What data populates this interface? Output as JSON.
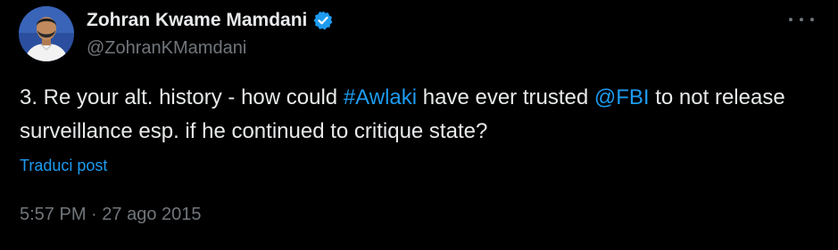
{
  "author": {
    "name": "Zohran Kwame Mamdani",
    "handle": "@ZohranKMamdani",
    "verified": true
  },
  "icons": {
    "verified": "verified-badge-icon",
    "more": "more-options-icon",
    "avatar": "profile-avatar"
  },
  "tweet": {
    "text_part1": "3. Re your alt. history - how could ",
    "hashtag": "#Awlaki",
    "text_part2": " have ever trusted ",
    "mention": "@FBI",
    "text_part3": " to not release surveillance esp. if he continued to critique state?"
  },
  "translate_label": "Traduci post",
  "timestamp": {
    "time": "5:57 PM",
    "separator": " · ",
    "date": "27 ago 2015"
  },
  "colors": {
    "background": "#000000",
    "text": "#e7e9ea",
    "muted": "#71767b",
    "link": "#1d9bf0",
    "verified": "#1d9bf0"
  }
}
